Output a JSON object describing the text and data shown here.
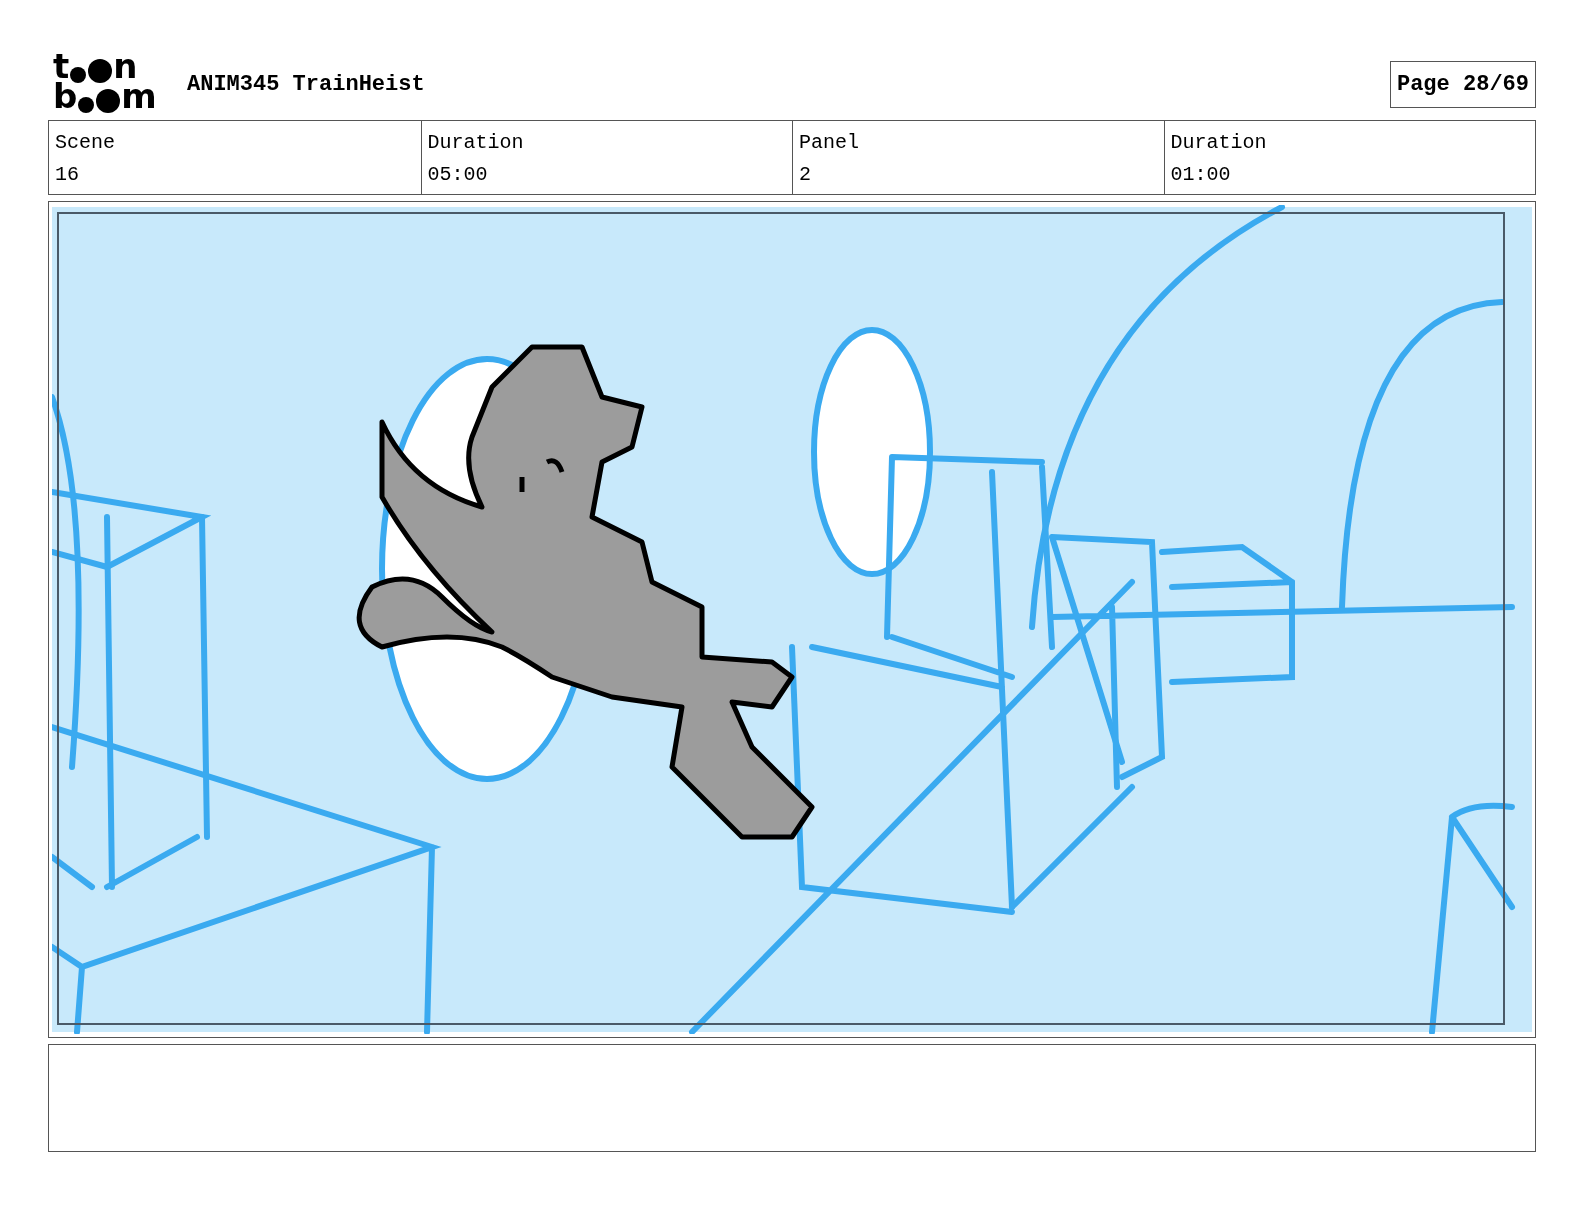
{
  "logo": {
    "top": [
      "t",
      "n"
    ],
    "bottom": [
      "b",
      "m"
    ]
  },
  "project_title": "ANIM345 TrainHeist",
  "page_label": "Page 28/69",
  "info_fields": [
    {
      "label": "Scene",
      "value": "16"
    },
    {
      "label": "Duration",
      "value": "05:00"
    },
    {
      "label": "Panel",
      "value": "2"
    },
    {
      "label": "Duration",
      "value": "01:00"
    }
  ]
}
